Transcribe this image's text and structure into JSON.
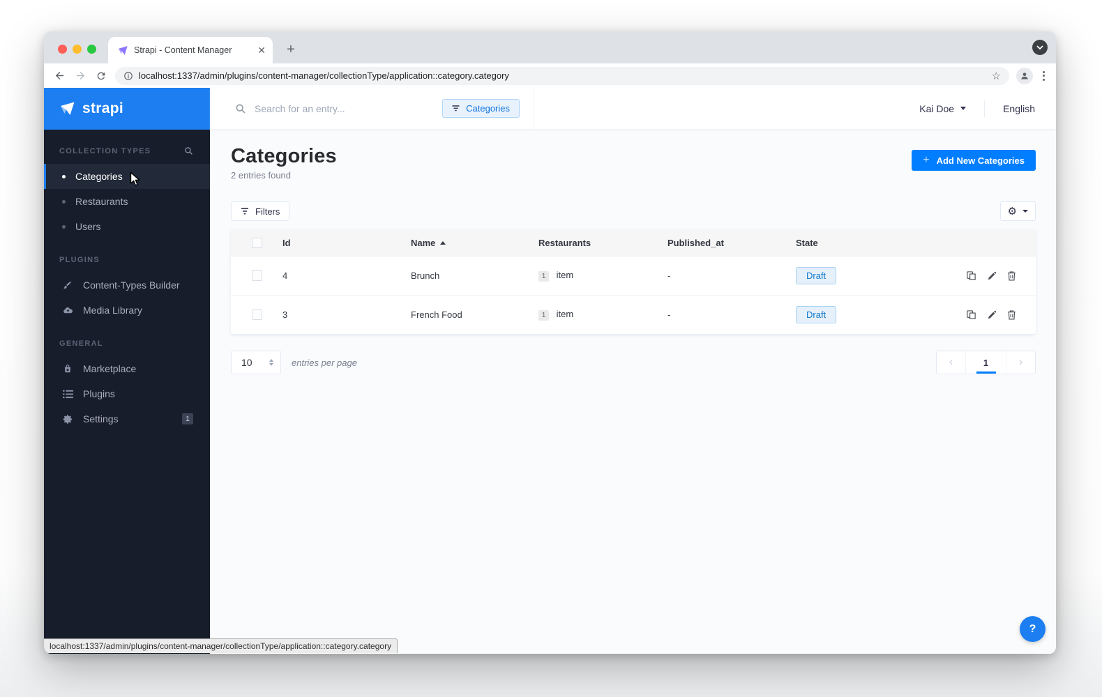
{
  "browser": {
    "tab_title": "Strapi - Content Manager",
    "url": "localhost:1337/admin/plugins/content-manager/collectionType/application::category.category"
  },
  "header": {
    "search_placeholder": "Search for an entry...",
    "filter_chip": "Categories",
    "user_name": "Kai Doe",
    "language": "English"
  },
  "sidebar": {
    "brand": "strapi",
    "collection_types": {
      "title": "COLLECTION TYPES",
      "items": [
        {
          "label": "Categories"
        },
        {
          "label": "Restaurants"
        },
        {
          "label": "Users"
        }
      ]
    },
    "plugins_section": {
      "title": "PLUGINS",
      "items": [
        {
          "label": "Content-Types Builder"
        },
        {
          "label": "Media Library"
        }
      ]
    },
    "general_section": {
      "title": "GENERAL",
      "items": [
        {
          "label": "Marketplace"
        },
        {
          "label": "Plugins"
        },
        {
          "label": "Settings",
          "badge": "1"
        }
      ]
    }
  },
  "page": {
    "title": "Categories",
    "subtitle": "2 entries found",
    "add_button": "Add New Categories",
    "filters_button": "Filters"
  },
  "table": {
    "headers": [
      "Id",
      "Name",
      "Restaurants",
      "Published_at",
      "State"
    ],
    "rows": [
      {
        "id": "4",
        "name": "Brunch",
        "restaurants_count": "1",
        "restaurants_label": "item",
        "published_at": "-",
        "state": "Draft"
      },
      {
        "id": "3",
        "name": "French Food",
        "restaurants_count": "1",
        "restaurants_label": "item",
        "published_at": "-",
        "state": "Draft"
      }
    ]
  },
  "pagination": {
    "per_page": "10",
    "per_page_label": "entries per page",
    "current_page": "1"
  },
  "status_bar": {
    "url": "localhost:1337/admin/plugins/content-manager/collectionType/application::category.category"
  },
  "help": {
    "label": "?"
  },
  "colors": {
    "brand_blue": "#1c7ef0",
    "accent_blue": "#007eff",
    "sidebar_dark": "#181d2b",
    "draft_bg": "#e6f0fb",
    "draft_text": "#107ace"
  }
}
